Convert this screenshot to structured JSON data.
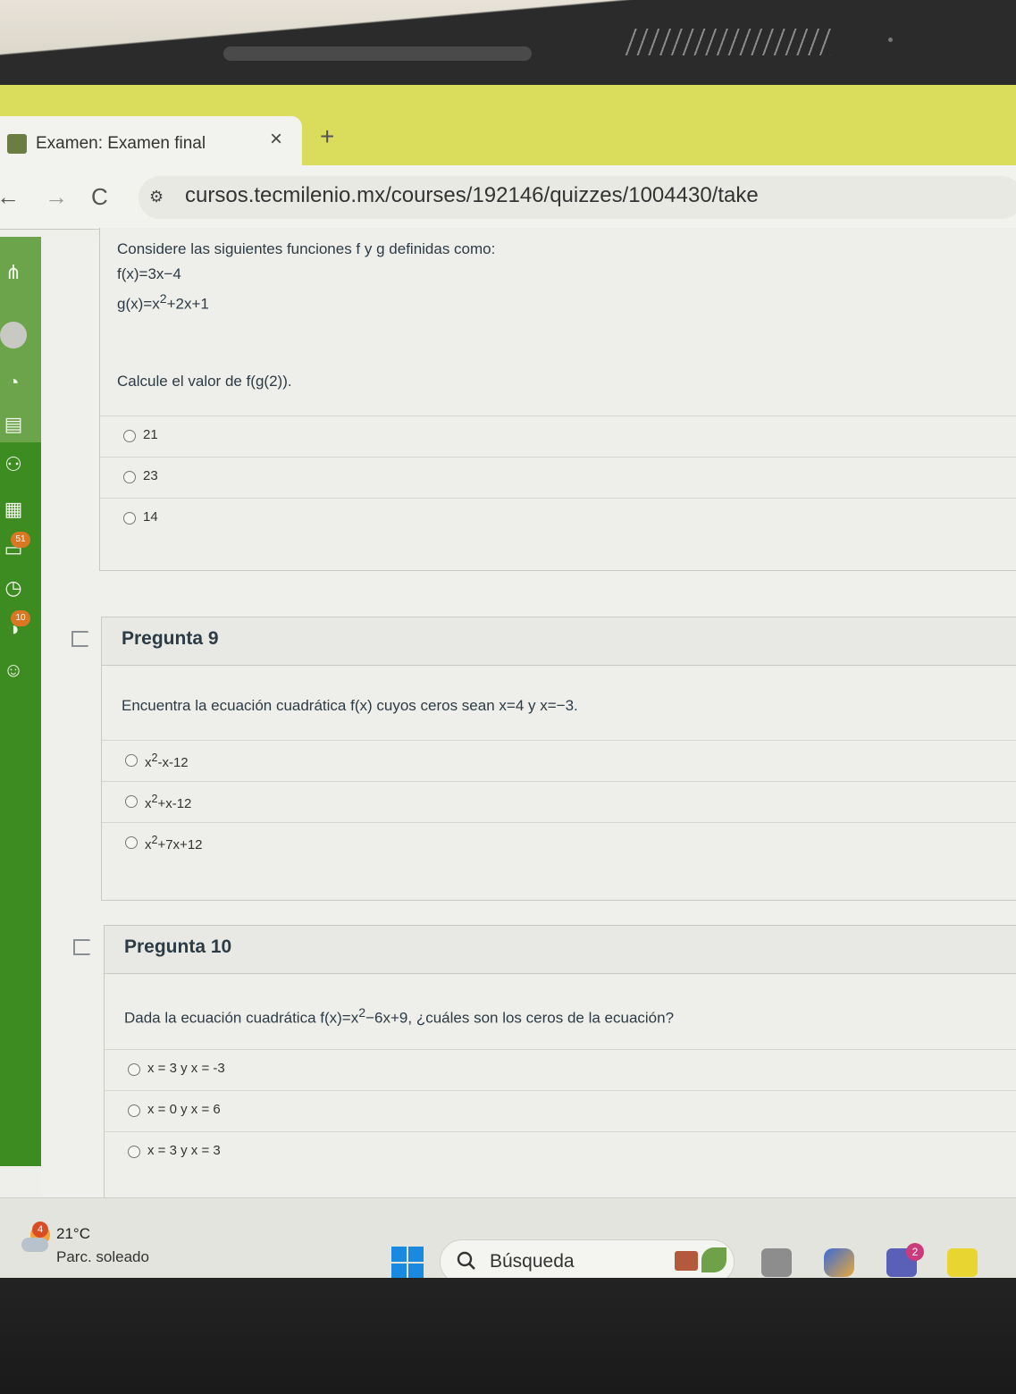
{
  "browser": {
    "tab_title": "Examen: Examen final",
    "tab_close": "×",
    "new_tab": "+",
    "url": "cursos.tecmilenio.mx/courses/192146/quizzes/1004430/take",
    "nav_back": "←",
    "nav_forward": "→",
    "nav_reload": "C"
  },
  "sidebar": {
    "badge_inbox": "51",
    "badge_history": "10"
  },
  "question8": {
    "intro": "Considere las siguientes funciones f y g definidas como:",
    "f_def": "f(x)=3x−4",
    "g_prefix": "g(x)=x",
    "g_exp": "2",
    "g_suffix": "+2x+1",
    "prompt": "Calcule el valor de f(g(2)).",
    "answers": [
      "21",
      "23",
      "14"
    ]
  },
  "question9": {
    "title": "Pregunta 9",
    "prompt": "Encuentra la ecuación cuadrática f(x) cuyos ceros sean x=4 y x=−3.",
    "answers": [
      {
        "base": "x",
        "exp": "2",
        "rest": "-x-12"
      },
      {
        "base": "x",
        "exp": "2",
        "rest": "+x-12"
      },
      {
        "base": "x",
        "exp": "2",
        "rest": "+7x+12"
      }
    ]
  },
  "question10": {
    "title": "Pregunta 10",
    "prompt_prefix": "Dada la ecuación cuadrática f(x)=x",
    "prompt_exp": "2",
    "prompt_suffix": "−6x+9, ¿cuáles son los ceros de la ecuación?",
    "answers": [
      "x = 3 y x = -3",
      "x = 0 y x = 6",
      "x = 3 y x = 3"
    ]
  },
  "taskbar": {
    "weather_badge": "4",
    "temperature": "21°C",
    "condition": "Parc. soleado",
    "search_label": "Búsqueda",
    "teams_badge": "2"
  },
  "colors": {
    "tabbar": "#dadd5c",
    "canvas_nav": "#3d8c22",
    "badge": "#d97722"
  }
}
